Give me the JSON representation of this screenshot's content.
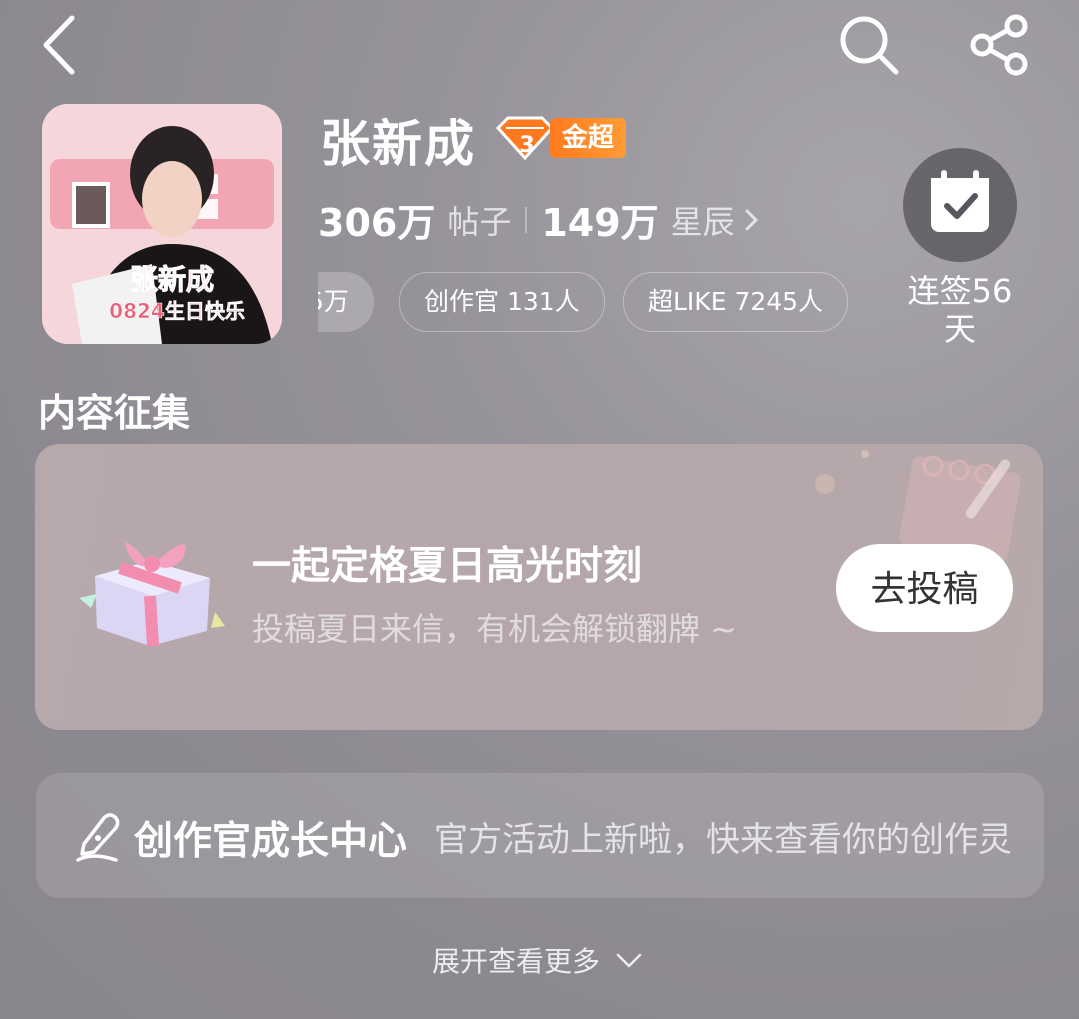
{
  "topbar": {
    "back_icon": "back-icon",
    "search_icon": "search-icon",
    "share_icon": "share-icon"
  },
  "header": {
    "title": "张新成",
    "badge_level": "3",
    "badge_label": "金超",
    "posts_count": "306万",
    "posts_unit": "帖子",
    "stars_count": "149万",
    "stars_unit": "星辰",
    "chips": [
      "5万",
      "创作官 131人",
      "超LIKE 7245人"
    ],
    "avatar_text": [
      "张新成",
      "0824生日快乐"
    ],
    "checkin_label": "连签56天"
  },
  "collect": {
    "section_title": "内容征集",
    "card_title": "一起定格夏日高光时刻",
    "card_subtitle": "投稿夏日来信，有机会解锁翻牌 ~",
    "button_label": "去投稿"
  },
  "growth": {
    "title": "创作官成长中心",
    "description": "官方活动上新啦，快来查看你的创作灵"
  },
  "footer": {
    "expand_label": "展开查看更多"
  },
  "colors": {
    "badge_orange": "#ff8a2a",
    "background": "#9a969d"
  }
}
